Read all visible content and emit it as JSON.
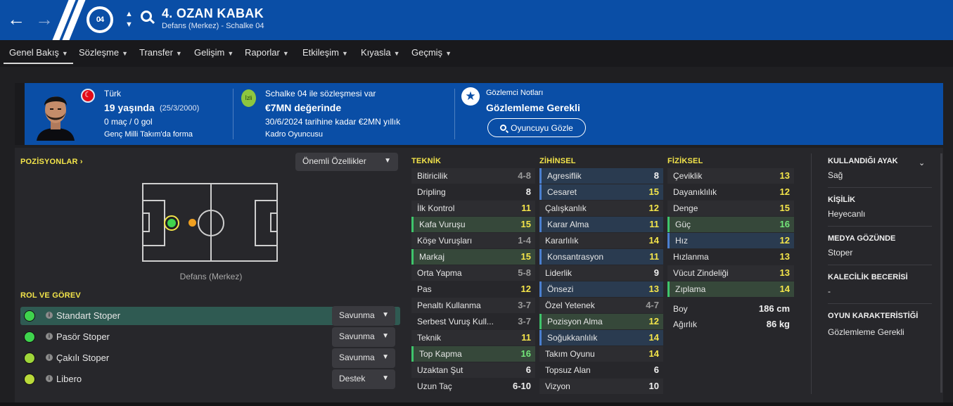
{
  "header": {
    "player_title": "4. OZAN KABAK",
    "player_subtitle": "Defans (Merkez) - Schalke 04",
    "crest_text": "04",
    "accent": "#0a4ea6"
  },
  "menu": {
    "items": [
      "Genel Bakış",
      "Sözleşme",
      "Transfer",
      "Gelişim",
      "Raporlar",
      "Etkileşim",
      "Kıyasla",
      "Geçmiş"
    ]
  },
  "info": {
    "nationality": "Türk",
    "age": "19 yaşında",
    "dob": "(25/3/2000)",
    "caps": "0 maç / 0 gol",
    "youth": "Genç Milli Takım'da forma",
    "contract_badge": "İzli",
    "contract_line": "Schalke 04 ile sözleşmesi var",
    "value": "€7MN değerinde",
    "contract_until": "30/6/2024 tarihine kadar €2MN yıllık",
    "squad_status": "Kadro Oyuncusu",
    "scout_title": "Gözlemci Notları",
    "scout_status": "Gözlemleme Gerekli",
    "scout_button": "Oyuncuyu Gözle"
  },
  "positions": {
    "title": "POZİSYONLAR",
    "dropdown": "Önemli Özellikler",
    "position_label": "Defans (Merkez)"
  },
  "roles": {
    "title": "ROL VE GÖREV",
    "items": [
      {
        "name": "Standart Stoper",
        "duty": "Savunma",
        "dot": "#3fd34d"
      },
      {
        "name": "Pasör Stoper",
        "duty": "Savunma",
        "dot": "#3fd34d"
      },
      {
        "name": "Çakılı Stoper",
        "duty": "Savunma",
        "dot": "#9fd63a"
      },
      {
        "name": "Libero",
        "duty": "Destek",
        "dot": "#b9d93a"
      }
    ]
  },
  "attributes": {
    "technical_title": "TEKNİK",
    "mental_title": "ZİHİNSEL",
    "physical_title": "FİZİKSEL",
    "technical": [
      {
        "name": "Bitiricilik",
        "value": "4-8",
        "style": "grey",
        "hl": "alt"
      },
      {
        "name": "Dripling",
        "value": "8",
        "style": "white",
        "hl": ""
      },
      {
        "name": "İlk Kontrol",
        "value": "11",
        "style": "yellow",
        "hl": "alt"
      },
      {
        "name": "Kafa Vuruşu",
        "value": "15",
        "style": "yellow",
        "hl": "green"
      },
      {
        "name": "Köşe Vuruşları",
        "value": "1-4",
        "style": "grey",
        "hl": "alt"
      },
      {
        "name": "Markaj",
        "value": "15",
        "style": "yellow",
        "hl": "green"
      },
      {
        "name": "Orta Yapma",
        "value": "5-8",
        "style": "grey",
        "hl": "alt"
      },
      {
        "name": "Pas",
        "value": "12",
        "style": "yellow",
        "hl": ""
      },
      {
        "name": "Penaltı Kullanma",
        "value": "3-7",
        "style": "grey",
        "hl": "alt"
      },
      {
        "name": "Serbest Vuruş Kull...",
        "value": "3-7",
        "style": "grey",
        "hl": ""
      },
      {
        "name": "Teknik",
        "value": "11",
        "style": "yellow",
        "hl": "alt"
      },
      {
        "name": "Top Kapma",
        "value": "16",
        "style": "green",
        "hl": "green"
      },
      {
        "name": "Uzaktan Şut",
        "value": "6",
        "style": "white",
        "hl": "alt"
      },
      {
        "name": "Uzun Taç",
        "value": "6-10",
        "style": "white",
        "hl": ""
      }
    ],
    "mental": [
      {
        "name": "Agresiflik",
        "value": "8",
        "style": "white",
        "hl": "blue"
      },
      {
        "name": "Cesaret",
        "value": "15",
        "style": "yellow",
        "hl": "blue"
      },
      {
        "name": "Çalışkanlık",
        "value": "12",
        "style": "yellow",
        "hl": "alt"
      },
      {
        "name": "Karar Alma",
        "value": "11",
        "style": "yellow",
        "hl": "blue"
      },
      {
        "name": "Kararlılık",
        "value": "14",
        "style": "yellow",
        "hl": "alt"
      },
      {
        "name": "Konsantrasyon",
        "value": "11",
        "style": "yellow",
        "hl": "blue"
      },
      {
        "name": "Liderlik",
        "value": "9",
        "style": "white",
        "hl": "alt"
      },
      {
        "name": "Önsezi",
        "value": "13",
        "style": "yellow",
        "hl": "blue"
      },
      {
        "name": "Özel Yetenek",
        "value": "4-7",
        "style": "grey",
        "hl": "alt"
      },
      {
        "name": "Pozisyon Alma",
        "value": "12",
        "style": "yellow",
        "hl": "green"
      },
      {
        "name": "Soğukkanlılık",
        "value": "14",
        "style": "yellow",
        "hl": "blue"
      },
      {
        "name": "Takım Oyunu",
        "value": "14",
        "style": "yellow",
        "hl": "alt"
      },
      {
        "name": "Topsuz Alan",
        "value": "6",
        "style": "white",
        "hl": ""
      },
      {
        "name": "Vizyon",
        "value": "10",
        "style": "white",
        "hl": "alt"
      }
    ],
    "physical": [
      {
        "name": "Çeviklik",
        "value": "13",
        "style": "yellow",
        "hl": "alt"
      },
      {
        "name": "Dayanıklılık",
        "value": "12",
        "style": "yellow",
        "hl": ""
      },
      {
        "name": "Denge",
        "value": "15",
        "style": "yellow",
        "hl": "alt"
      },
      {
        "name": "Güç",
        "value": "16",
        "style": "green",
        "hl": "green"
      },
      {
        "name": "Hız",
        "value": "12",
        "style": "yellow",
        "hl": "blue"
      },
      {
        "name": "Hızlanma",
        "value": "13",
        "style": "yellow",
        "hl": ""
      },
      {
        "name": "Vücut Zindeliği",
        "value": "13",
        "style": "yellow",
        "hl": "alt"
      },
      {
        "name": "Zıplama",
        "value": "14",
        "style": "yellow",
        "hl": "green"
      }
    ],
    "height_label": "Boy",
    "height_value": "186 cm",
    "weight_label": "Ağırlık",
    "weight_value": "86 kg"
  },
  "details": {
    "foot_title": "KULLANDIĞI AYAK",
    "foot_value": "Sağ",
    "personality_title": "KİŞİLİK",
    "personality_value": "Heyecanlı",
    "media_title": "MEDYA GÖZÜNDE",
    "media_value": "Stoper",
    "gk_title": "KALECİLİK BECERİSİ",
    "gk_value": "-",
    "playstyle_title": "OYUN KARAKTERİSTİĞİ",
    "playstyle_value": "Gözlemleme Gerekli"
  }
}
